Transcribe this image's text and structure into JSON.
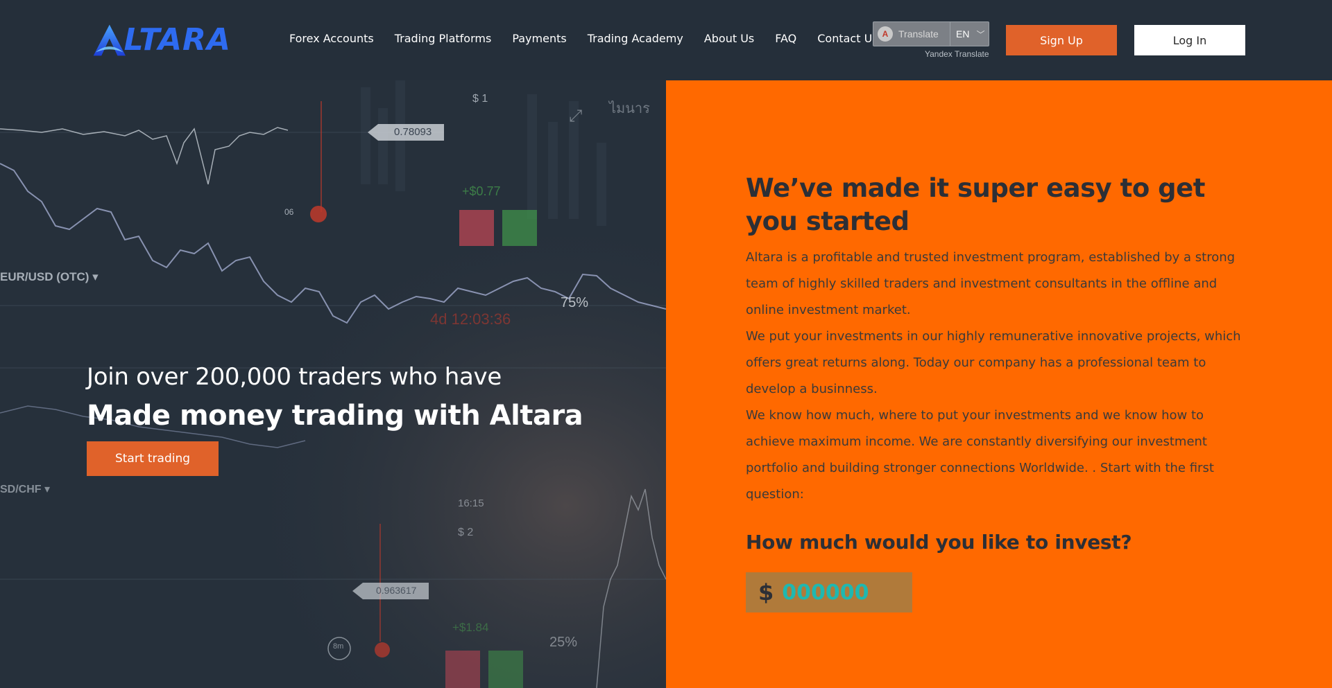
{
  "header": {
    "logo_text": "LTARA",
    "nav": [
      {
        "label": "Forex Accounts"
      },
      {
        "label": "Trading Platforms"
      },
      {
        "label": "Payments"
      },
      {
        "label": "Trading Academy"
      },
      {
        "label": "About Us"
      },
      {
        "label": "FAQ"
      },
      {
        "label": "Contact Us"
      }
    ],
    "translate": {
      "label": "Translate",
      "language": "EN",
      "provider": "Yandex Translate"
    },
    "signup_label": "Sign Up",
    "login_label": "Log In"
  },
  "hero": {
    "subtitle": "Join over 200,000 traders who have",
    "title": "Made money trading with Altara",
    "cta_label": "Start trading",
    "chart_labels": {
      "price1": "0.78093",
      "price2": "0.963617",
      "pair1": "EUR/USD (OTC) ▾",
      "pair2": "SD/CHF ▾",
      "pct1": "75%",
      "pct2": "25%",
      "amount1": "$ 1",
      "amount2": "$ 2",
      "time": "16:15",
      "profit1": "+$0.77",
      "profit2": "+$1.84",
      "expiry": "4d 12:03:36",
      "marker": "06",
      "timer": "8m",
      "badge": "ไมนาร"
    }
  },
  "panel": {
    "heading": "We’ve made it super easy to get you started",
    "paragraphs": [
      "Altara is a profitable and trusted investment program, established by a strong team of highly skilled traders and investment consultants in the offline and online investment market.",
      "We put your investments in our highly remunerative innovative projects, which offers great returns along. Today our company has a professional team to develop a businness.",
      "We know how much, where to put your investments and we know how to achieve maximum income. We are constantly diversifying our investment portfolio and building stronger connections Worldwide. . Start with the first question:"
    ],
    "invest_question": "How much would you like to invest?",
    "currency": "$",
    "amount_placeholder": "000000"
  },
  "colors": {
    "header_bg": "#252f3a",
    "accent_orange": "#e0622a",
    "panel_orange": "#ff6900",
    "logo_blue": "#2e6bf0",
    "input_text": "#1fb8b0"
  }
}
